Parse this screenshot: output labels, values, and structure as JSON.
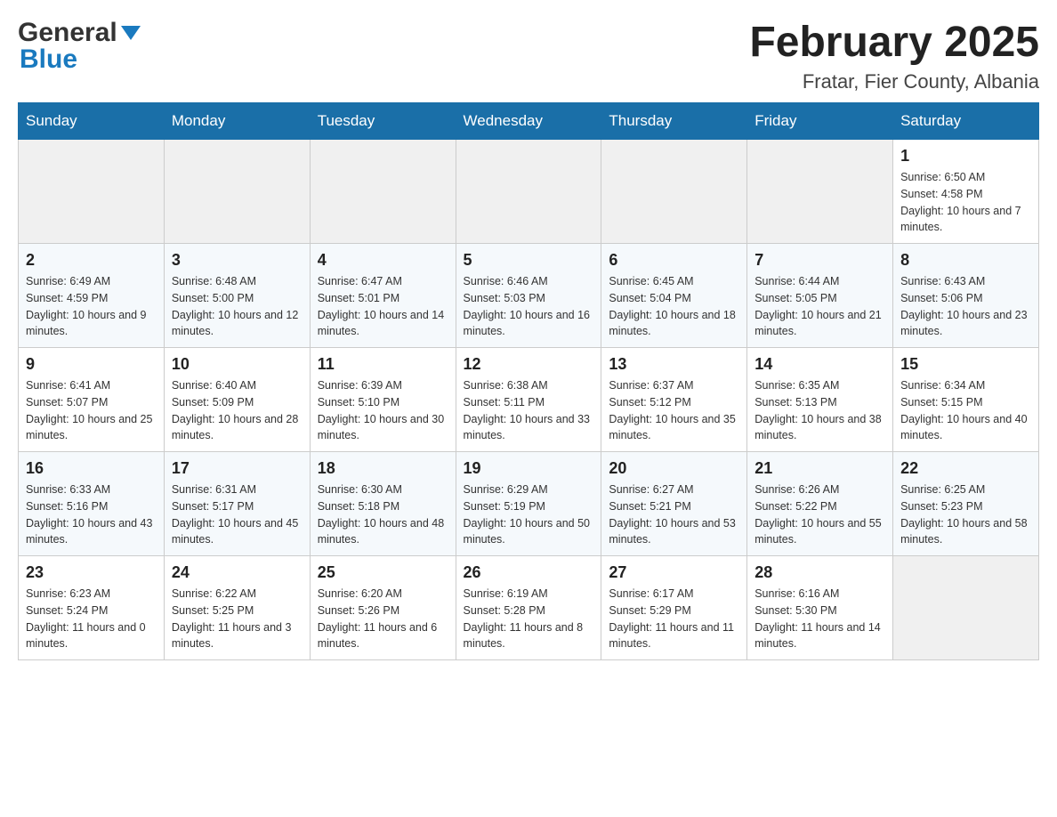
{
  "header": {
    "logo_general": "General",
    "logo_blue": "Blue",
    "month_title": "February 2025",
    "location": "Fratar, Fier County, Albania"
  },
  "weekdays": [
    "Sunday",
    "Monday",
    "Tuesday",
    "Wednesday",
    "Thursday",
    "Friday",
    "Saturday"
  ],
  "weeks": [
    [
      {
        "day": "",
        "info": ""
      },
      {
        "day": "",
        "info": ""
      },
      {
        "day": "",
        "info": ""
      },
      {
        "day": "",
        "info": ""
      },
      {
        "day": "",
        "info": ""
      },
      {
        "day": "",
        "info": ""
      },
      {
        "day": "1",
        "info": "Sunrise: 6:50 AM\nSunset: 4:58 PM\nDaylight: 10 hours and 7 minutes."
      }
    ],
    [
      {
        "day": "2",
        "info": "Sunrise: 6:49 AM\nSunset: 4:59 PM\nDaylight: 10 hours and 9 minutes."
      },
      {
        "day": "3",
        "info": "Sunrise: 6:48 AM\nSunset: 5:00 PM\nDaylight: 10 hours and 12 minutes."
      },
      {
        "day": "4",
        "info": "Sunrise: 6:47 AM\nSunset: 5:01 PM\nDaylight: 10 hours and 14 minutes."
      },
      {
        "day": "5",
        "info": "Sunrise: 6:46 AM\nSunset: 5:03 PM\nDaylight: 10 hours and 16 minutes."
      },
      {
        "day": "6",
        "info": "Sunrise: 6:45 AM\nSunset: 5:04 PM\nDaylight: 10 hours and 18 minutes."
      },
      {
        "day": "7",
        "info": "Sunrise: 6:44 AM\nSunset: 5:05 PM\nDaylight: 10 hours and 21 minutes."
      },
      {
        "day": "8",
        "info": "Sunrise: 6:43 AM\nSunset: 5:06 PM\nDaylight: 10 hours and 23 minutes."
      }
    ],
    [
      {
        "day": "9",
        "info": "Sunrise: 6:41 AM\nSunset: 5:07 PM\nDaylight: 10 hours and 25 minutes."
      },
      {
        "day": "10",
        "info": "Sunrise: 6:40 AM\nSunset: 5:09 PM\nDaylight: 10 hours and 28 minutes."
      },
      {
        "day": "11",
        "info": "Sunrise: 6:39 AM\nSunset: 5:10 PM\nDaylight: 10 hours and 30 minutes."
      },
      {
        "day": "12",
        "info": "Sunrise: 6:38 AM\nSunset: 5:11 PM\nDaylight: 10 hours and 33 minutes."
      },
      {
        "day": "13",
        "info": "Sunrise: 6:37 AM\nSunset: 5:12 PM\nDaylight: 10 hours and 35 minutes."
      },
      {
        "day": "14",
        "info": "Sunrise: 6:35 AM\nSunset: 5:13 PM\nDaylight: 10 hours and 38 minutes."
      },
      {
        "day": "15",
        "info": "Sunrise: 6:34 AM\nSunset: 5:15 PM\nDaylight: 10 hours and 40 minutes."
      }
    ],
    [
      {
        "day": "16",
        "info": "Sunrise: 6:33 AM\nSunset: 5:16 PM\nDaylight: 10 hours and 43 minutes."
      },
      {
        "day": "17",
        "info": "Sunrise: 6:31 AM\nSunset: 5:17 PM\nDaylight: 10 hours and 45 minutes."
      },
      {
        "day": "18",
        "info": "Sunrise: 6:30 AM\nSunset: 5:18 PM\nDaylight: 10 hours and 48 minutes."
      },
      {
        "day": "19",
        "info": "Sunrise: 6:29 AM\nSunset: 5:19 PM\nDaylight: 10 hours and 50 minutes."
      },
      {
        "day": "20",
        "info": "Sunrise: 6:27 AM\nSunset: 5:21 PM\nDaylight: 10 hours and 53 minutes."
      },
      {
        "day": "21",
        "info": "Sunrise: 6:26 AM\nSunset: 5:22 PM\nDaylight: 10 hours and 55 minutes."
      },
      {
        "day": "22",
        "info": "Sunrise: 6:25 AM\nSunset: 5:23 PM\nDaylight: 10 hours and 58 minutes."
      }
    ],
    [
      {
        "day": "23",
        "info": "Sunrise: 6:23 AM\nSunset: 5:24 PM\nDaylight: 11 hours and 0 minutes."
      },
      {
        "day": "24",
        "info": "Sunrise: 6:22 AM\nSunset: 5:25 PM\nDaylight: 11 hours and 3 minutes."
      },
      {
        "day": "25",
        "info": "Sunrise: 6:20 AM\nSunset: 5:26 PM\nDaylight: 11 hours and 6 minutes."
      },
      {
        "day": "26",
        "info": "Sunrise: 6:19 AM\nSunset: 5:28 PM\nDaylight: 11 hours and 8 minutes."
      },
      {
        "day": "27",
        "info": "Sunrise: 6:17 AM\nSunset: 5:29 PM\nDaylight: 11 hours and 11 minutes."
      },
      {
        "day": "28",
        "info": "Sunrise: 6:16 AM\nSunset: 5:30 PM\nDaylight: 11 hours and 14 minutes."
      },
      {
        "day": "",
        "info": ""
      }
    ]
  ]
}
